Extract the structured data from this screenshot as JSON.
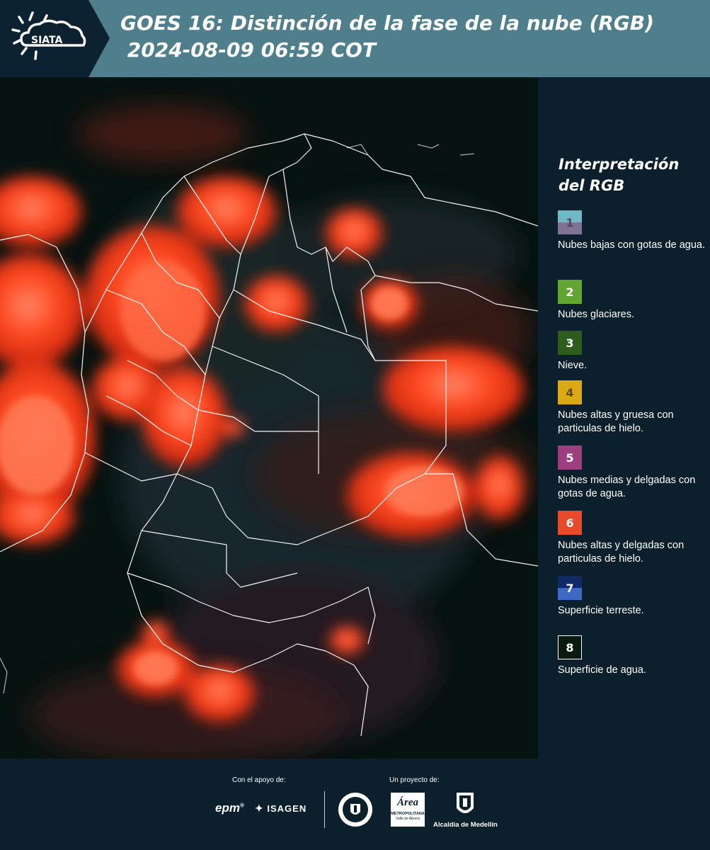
{
  "header": {
    "logo_text": "SIATA",
    "title_line1": "GOES 16: Distinción de la fase de la nube (RGB)",
    "title_line2": " 2024-08-09 06:59 COT"
  },
  "legend": {
    "title_line1": "Interpretación",
    "title_line2": "del RGB",
    "items": [
      {
        "number": "1",
        "label": "Nubes bajas con gotas de agua.",
        "color_top": "#6fb9c6",
        "color_bottom": "#7e7392",
        "text_color": "#4a4a5a"
      },
      {
        "number": "2",
        "label": "Nubes glaciares.",
        "color_top": "#62a531",
        "color_bottom": "#62a531",
        "text_color": "#ffffff"
      },
      {
        "number": "3",
        "label": "Nieve.",
        "color_top": "#2e5c1c",
        "color_bottom": "#2e5c1c",
        "text_color": "#ffffff"
      },
      {
        "number": "4",
        "label": "Nubes altas y gruesa con particulas de hielo.",
        "color_top": "#d9a916",
        "color_bottom": "#d9a916",
        "text_color": "#5a4a10"
      },
      {
        "number": "5",
        "label": "Nubes medias y delgadas con gotas de agua.",
        "color_top": "#9b3f7e",
        "color_bottom": "#9b3f7e",
        "text_color": "#ffffff"
      },
      {
        "number": "6",
        "label": "Nubes altas y delgadas con particulas de hielo.",
        "color_top": "#e84a2a",
        "color_bottom": "#e84a2a",
        "text_color": "#ffffff"
      },
      {
        "number": "7",
        "label": "Superficie terreste.",
        "color_top": "#0f2a66",
        "color_bottom": "#3f69c4",
        "text_color": "#ffffff"
      },
      {
        "number": "8",
        "label": "Superficie de agua.",
        "color_top": "#0b1a10",
        "color_bottom": "#0b1a10",
        "text_color": "#ffffff"
      }
    ]
  },
  "footer": {
    "support_label": "Con el apoyo de:",
    "project_label": "Un proyecto de:",
    "epm": "epm",
    "isagen": "ISAGEN",
    "area_name": "Área",
    "area_sub": "METROPOLITANA",
    "area_sub2": "Valle de Aburrá",
    "alcaldia": "Alcaldía de Medellín"
  },
  "colors": {
    "header_bg": "#4f7e8c",
    "logo_bg": "#0d2230",
    "panel_bg": "#0c1f2c",
    "cloud_red": "#ff3a18"
  }
}
